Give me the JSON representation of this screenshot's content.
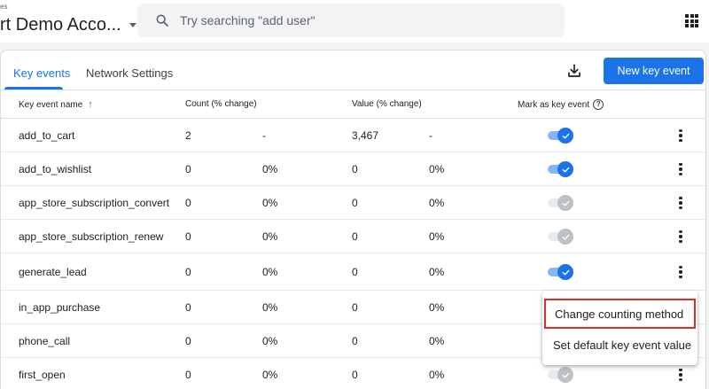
{
  "header": {
    "breadcrumb": "es",
    "account_name": "rt Demo Acco...",
    "search_placeholder": "Try searching \"add user\""
  },
  "tabs": [
    {
      "label": "Key events",
      "active": true
    },
    {
      "label": "Network Settings",
      "active": false
    }
  ],
  "toolbar": {
    "new_button_label": "New key event"
  },
  "table": {
    "headers": {
      "name": "Key event name",
      "sort": "↑",
      "count": "Count (% change)",
      "value": "Value (% change)",
      "mark": "Mark as key event",
      "help": "?"
    },
    "rows": [
      {
        "name": "add_to_cart",
        "count": "2",
        "count_change": "-",
        "value": "3,467",
        "value_change": "-",
        "marked": true
      },
      {
        "name": "add_to_wishlist",
        "count": "0",
        "count_change": "0%",
        "value": "0",
        "value_change": "0%",
        "marked": true
      },
      {
        "name": "app_store_subscription_convert",
        "count": "0",
        "count_change": "0%",
        "value": "0",
        "value_change": "0%",
        "marked": false
      },
      {
        "name": "app_store_subscription_renew",
        "count": "0",
        "count_change": "0%",
        "value": "0",
        "value_change": "0%",
        "marked": false
      },
      {
        "name": "generate_lead",
        "count": "0",
        "count_change": "0%",
        "value": "0",
        "value_change": "0%",
        "marked": true
      },
      {
        "name": "in_app_purchase",
        "count": "0",
        "count_change": "0%",
        "value": "0",
        "value_change": "0%",
        "marked": true
      },
      {
        "name": "phone_call",
        "count": "0",
        "count_change": "0%",
        "value": "0",
        "value_change": "0%",
        "marked": true
      },
      {
        "name": "first_open",
        "count": "0",
        "count_change": "0%",
        "value": "0",
        "value_change": "0%",
        "marked": false
      }
    ]
  },
  "context_menu": {
    "items": [
      {
        "label": "Change counting method",
        "highlighted": true
      },
      {
        "label": "Set default key event value",
        "highlighted": false
      }
    ]
  },
  "colors": {
    "accent": "#1a73e8",
    "highlight_border": "#d93025",
    "toggle_on_track": "#8ab4f8",
    "toggle_off_knob": "#bdc1c6"
  }
}
